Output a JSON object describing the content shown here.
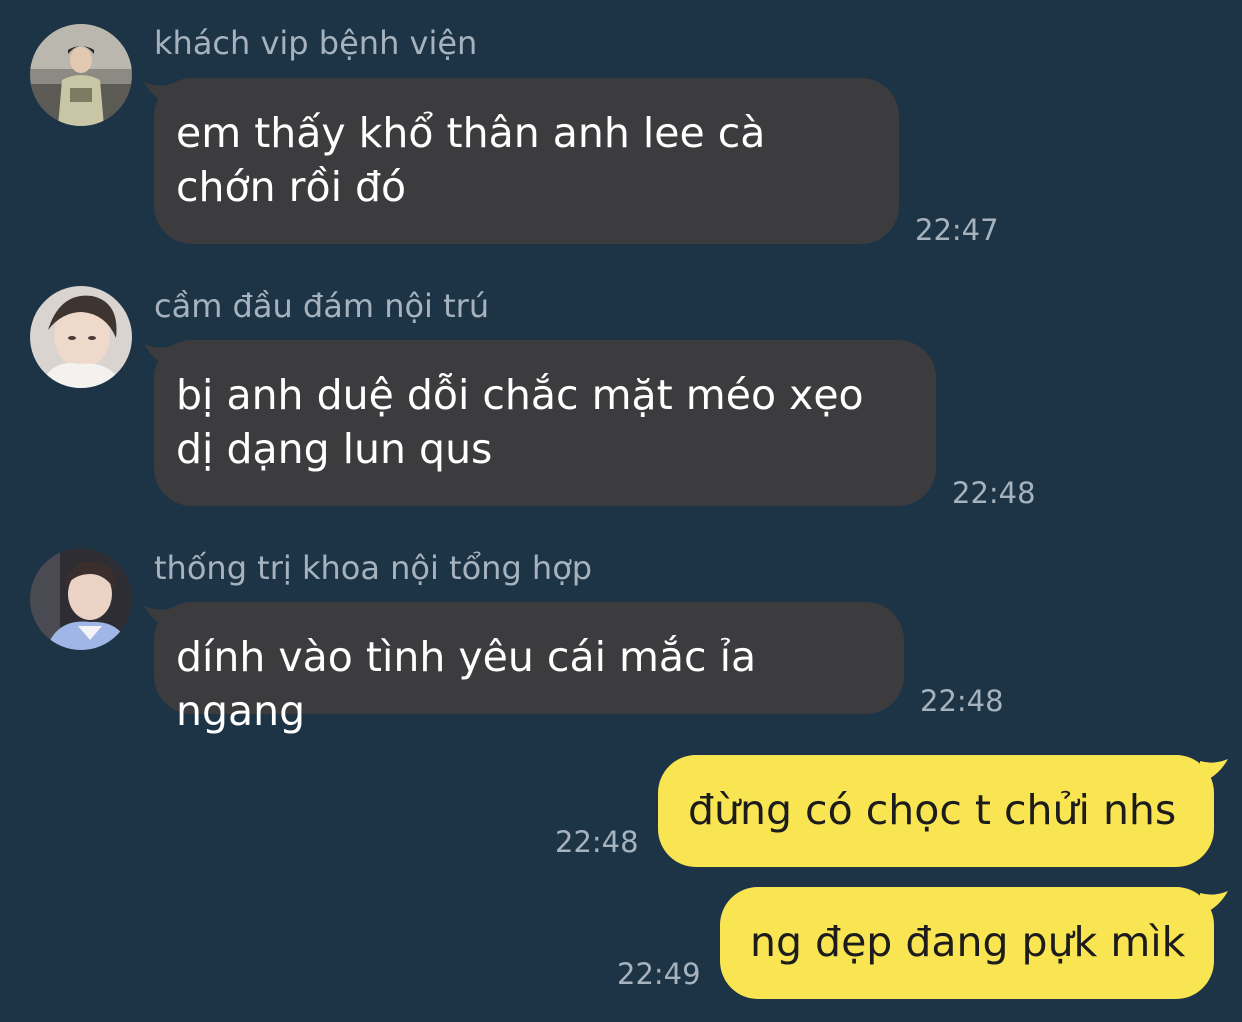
{
  "conversation": {
    "colors": {
      "background": "#1d3346",
      "incoming_bubble": "#3c3c3e",
      "outgoing_bubble": "#f9e451",
      "meta_text": "#a6b3be"
    },
    "messages": [
      {
        "direction": "incoming",
        "sender": "khách vip bệnh viện",
        "text": "em thấy khổ thân anh lee cà chớn rồi đó",
        "time": "22:47",
        "avatar_icon": "user-avatar-icon"
      },
      {
        "direction": "incoming",
        "sender": "cầm đầu đám nội trú",
        "text": "bị anh duệ dỗi chắc mặt méo xẹo dị dạng lun qus",
        "time": "22:48",
        "avatar_icon": "user-avatar-icon"
      },
      {
        "direction": "incoming",
        "sender": "thống trị khoa nội tổng hợp",
        "text": "dính vào tình yêu cái mắc ỉa ngang",
        "time": "22:48",
        "avatar_icon": "user-avatar-icon"
      },
      {
        "direction": "outgoing",
        "text": "đừng có chọc t chửi nhs",
        "time": "22:48"
      },
      {
        "direction": "outgoing",
        "text": "ng đẹp đang pựk mìk",
        "time": "22:49"
      }
    ]
  }
}
